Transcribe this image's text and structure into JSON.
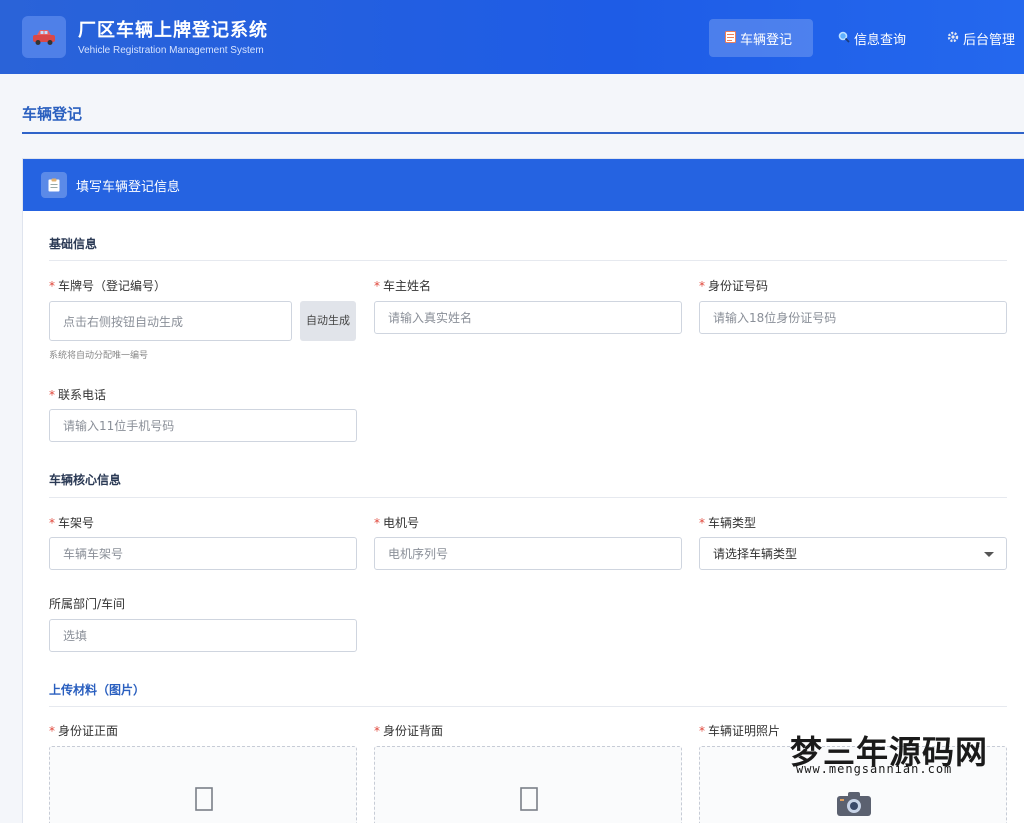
{
  "header": {
    "title": "厂区车辆上牌登记系统",
    "subtitle": "Vehicle Registration Management System",
    "nav": [
      {
        "label": "车辆登记",
        "icon": "form-icon"
      },
      {
        "label": "信息查询",
        "icon": "search-icon"
      },
      {
        "label": "后台管理",
        "icon": "gear-icon"
      }
    ],
    "active_nav": "车辆登记"
  },
  "page": {
    "title": "车辆登记"
  },
  "card": {
    "title": "填写车辆登记信息"
  },
  "sections": {
    "basic": "基础信息",
    "core": "车辆核心信息",
    "upload": "上传材料（图片）"
  },
  "fields": {
    "plate": {
      "label": "车牌号（登记编号）",
      "placeholder": "点击右侧按钮自动生成",
      "button": "自动生成",
      "hint": "系统将自动分配唯一编号"
    },
    "owner": {
      "label": "车主姓名",
      "placeholder": "请输入真实姓名"
    },
    "idcard": {
      "label": "身份证号码",
      "placeholder": "请输入18位身份证号码"
    },
    "phone": {
      "label": "联系电话",
      "placeholder": "请输入11位手机号码"
    },
    "frame": {
      "label": "车架号",
      "placeholder": "车辆车架号"
    },
    "motor": {
      "label": "电机号",
      "placeholder": "电机序列号"
    },
    "type": {
      "label": "车辆类型",
      "value": "请选择车辆类型"
    },
    "dept": {
      "label": "所属部门/车间",
      "placeholder": "选填"
    }
  },
  "uploads": {
    "id_front": "身份证正面",
    "id_back": "身份证背面",
    "vehicle_proof": "车辆证明照片"
  },
  "required_mark": "*",
  "watermark": {
    "cn": "梦三年源码网",
    "url": "www.mengsannian.com"
  },
  "colors": {
    "primary": "#2563e1",
    "required": "#e0473b"
  }
}
